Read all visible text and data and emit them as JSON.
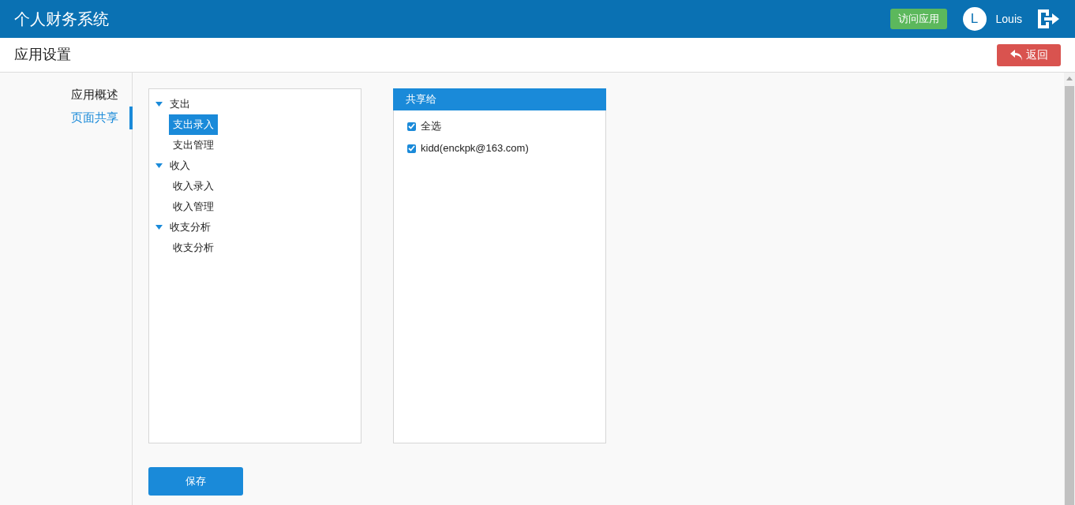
{
  "header": {
    "title": "个人财务系统",
    "visit_button": "访问应用",
    "avatar_letter": "L",
    "user_name": "Louis"
  },
  "subheader": {
    "title": "应用设置",
    "back_button": "返回"
  },
  "sidebar": {
    "items": [
      {
        "label": "应用概述",
        "selected": false
      },
      {
        "label": "页面共享",
        "selected": true
      }
    ]
  },
  "tree": [
    {
      "label": "支出",
      "expanded": true,
      "selected": false,
      "children": [
        {
          "label": "支出录入",
          "selected": true
        },
        {
          "label": "支出管理",
          "selected": false
        }
      ]
    },
    {
      "label": "收入",
      "expanded": true,
      "selected": false,
      "children": [
        {
          "label": "收入录入",
          "selected": false
        },
        {
          "label": "收入管理",
          "selected": false
        }
      ]
    },
    {
      "label": "收支分析",
      "expanded": true,
      "selected": false,
      "children": [
        {
          "label": "收支分析",
          "selected": false
        }
      ]
    }
  ],
  "share_panel": {
    "title": "共享给",
    "options": [
      {
        "label": "全选",
        "checked": true
      },
      {
        "label": "kidd(enckpk@163.com)",
        "checked": true
      }
    ]
  },
  "save_button": "保存"
}
